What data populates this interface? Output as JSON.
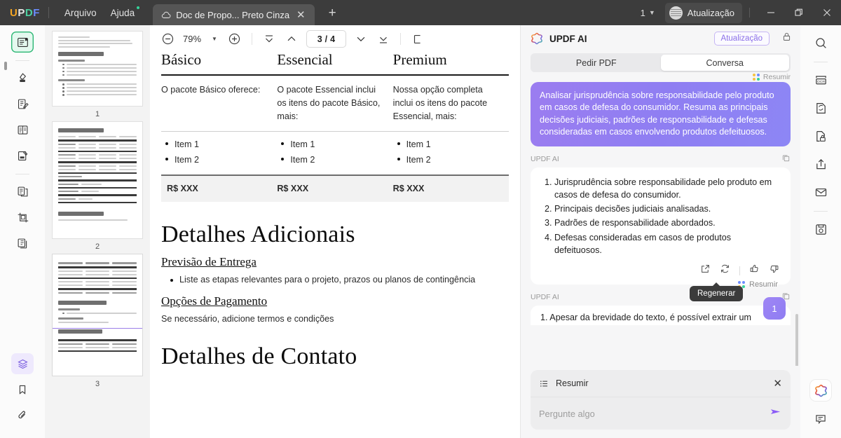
{
  "titlebar": {
    "logo": "UPDF",
    "logo_letters": [
      "U",
      "P",
      "D",
      "F"
    ],
    "menus": [
      "Arquivo",
      "Ajuda"
    ],
    "tab": {
      "title": "Doc de Propo... Preto Cinza",
      "cloud_icon": "cloud-icon",
      "close_icon": "close-icon"
    },
    "new_tab_icon": "plus-icon",
    "window_count": "1",
    "update_label": "Atualização",
    "window_buttons": {
      "minimize": "minimize-icon",
      "maximize": "maximize-icon",
      "close": "close-icon"
    }
  },
  "left_rail": {
    "items": [
      {
        "name": "reader-mode",
        "icon": "book-reader-icon",
        "selected": true
      },
      {
        "name": "highlight-tool",
        "icon": "highlighter-icon"
      },
      {
        "name": "edit-pdf-tool",
        "icon": "edit-document-icon"
      },
      {
        "name": "form-tool",
        "icon": "form-list-icon"
      },
      {
        "name": "annotate-tool",
        "icon": "annotate-icon"
      },
      {
        "name": "organize-pages",
        "icon": "pages-icon"
      },
      {
        "name": "crop-tool",
        "icon": "crop-icon"
      },
      {
        "name": "compare-tool",
        "icon": "compare-icon"
      }
    ],
    "bottom": [
      {
        "name": "layers-panel",
        "icon": "layers-icon",
        "selected": true
      },
      {
        "name": "bookmarks-panel",
        "icon": "bookmark-icon"
      },
      {
        "name": "attachments-panel",
        "icon": "paperclip-icon"
      }
    ]
  },
  "thumbnails": {
    "pages": [
      {
        "number": "1",
        "title": "Escopo do Trabalho",
        "current": false
      },
      {
        "number": "2",
        "title": "Orçamento",
        "subtitle": "Pacotes",
        "current": false
      },
      {
        "number": "3",
        "title": "Detalhes Adicionais",
        "current": true
      }
    ]
  },
  "pdf_toolbar": {
    "zoom_out_icon": "zoom-out-icon",
    "zoom_value": "79%",
    "zoom_dropdown_icon": "chevron-down-icon",
    "zoom_in_icon": "zoom-in-icon",
    "first_page_icon": "first-page-icon",
    "prev_page_icon": "prev-page-icon",
    "page_current": "3",
    "page_separator": "/",
    "page_total": "4",
    "next_page_icon": "next-page-icon",
    "last_page_icon": "last-page-icon",
    "select_tool_icon": "select-text-icon"
  },
  "document": {
    "table": {
      "headers": [
        "Básico",
        "Essencial",
        "Premium"
      ],
      "descriptions": [
        "O pacote Básico oferece:",
        "O pacote Essencial inclui os itens do pacote Básico, mais:",
        "Nossa opção completa inclui os itens do pacote Essencial, mais:"
      ],
      "items": [
        [
          "Item 1",
          "Item 2"
        ],
        [
          "Item 1",
          "Item 2"
        ],
        [
          "Item 1",
          "Item 2"
        ]
      ],
      "prices": [
        "R$ XXX",
        "R$ XXX",
        "R$ XXX"
      ]
    },
    "section_title": "Detalhes Adicionais",
    "subsection_1": "Previsão de Entrega",
    "bullet_1": "Liste as etapas relevantes para o projeto, prazos ou planos de contingência",
    "subsection_2": "Opções de Pagamento",
    "paragraph_1": "Se necessário, adicione termos e condições",
    "section_title_2": "Detalhes de Contato"
  },
  "ai_panel": {
    "title": "UPDF AI",
    "logo_icon": "updf-ai-icon",
    "update_button": "Atualização",
    "lock_icon": "lock-icon",
    "tabs": [
      {
        "label": "Pedir PDF",
        "active": false
      },
      {
        "label": "Conversa",
        "active": true
      }
    ],
    "top_tag": "Resumir",
    "user_message": "Analisar jurisprudência sobre responsabilidade pelo produto em casos de defesa do consumidor. Resuma as principais decisões judiciais, padrões de responsabilidade e defesas consideradas em casos envolvendo produtos defeituosos.",
    "ai_label": "UPDF AI",
    "copy_icon": "copy-icon",
    "ai_response_items": [
      "Jurisprudência sobre responsabilidade pelo produto em casos de defesa do consumidor.",
      "Principais decisões judiciais analisadas.",
      "Padrões de responsabilidade abordados.",
      "Defesas consideradas em casos de produtos defeituosos."
    ],
    "actions": {
      "export_icon": "export-icon",
      "regenerate_icon": "regenerate-icon",
      "thumbs_up_icon": "thumbs-up-icon",
      "thumbs_down_icon": "thumbs-down-icon"
    },
    "tooltip": "Regenerar",
    "floating_tag": "Resumir",
    "badge_count": "1",
    "second_ai_label": "UPDF AI",
    "second_response_partial": "1. Apesar da brevidade do texto, é possível extrair um",
    "composer": {
      "chip_icon": "list-icon",
      "chip_label": "Resumir",
      "chip_close_icon": "close-icon",
      "placeholder": "Pergunte algo",
      "send_icon": "send-icon"
    }
  },
  "right_rail": {
    "items": [
      {
        "name": "search",
        "icon": "search-icon"
      },
      {
        "name": "ocr",
        "icon": "ocr-icon"
      },
      {
        "name": "convert",
        "icon": "convert-icon"
      },
      {
        "name": "protect",
        "icon": "lock-document-icon"
      },
      {
        "name": "share",
        "icon": "share-icon"
      },
      {
        "name": "email",
        "icon": "email-icon"
      },
      {
        "name": "save",
        "icon": "save-icon"
      }
    ],
    "bottom": [
      {
        "name": "updf-ai",
        "icon": "updf-ai-icon"
      },
      {
        "name": "comments",
        "icon": "comment-icon"
      }
    ]
  },
  "colors": {
    "accent_purple": "#8b5cf6",
    "titlebar_bg": "#3c3c3c",
    "panel_bg": "#f6f6f7",
    "green_selected": "#2bb673"
  }
}
